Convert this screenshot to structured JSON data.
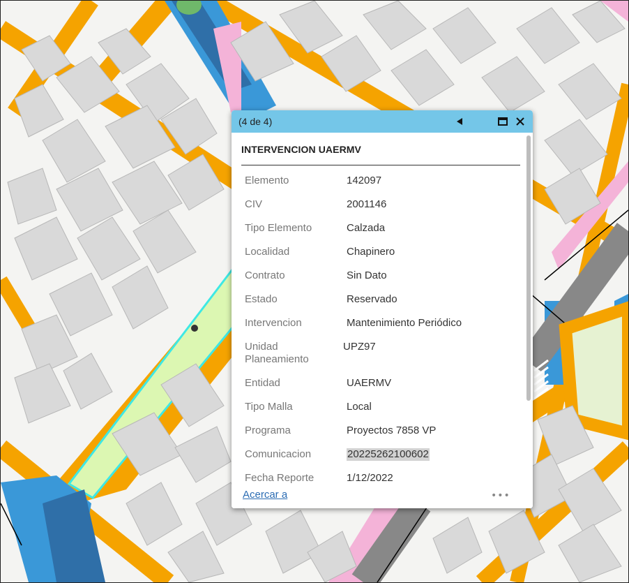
{
  "popup": {
    "counter": "(4 de 4)",
    "prev_icon": "triangle-left-icon",
    "maximize_icon": "maximize-icon",
    "close_icon": "close-icon",
    "title": "INTERVENCION UAERMV",
    "rows": [
      {
        "label": "Elemento",
        "value": "142097"
      },
      {
        "label": "CIV",
        "value": "2001146"
      },
      {
        "label": "Tipo Elemento",
        "value": "Calzada"
      },
      {
        "label": "Localidad",
        "value": "Chapinero"
      },
      {
        "label": "Contrato",
        "value": "Sin Dato"
      },
      {
        "label": "Estado",
        "value": "Reservado"
      },
      {
        "label": "Intervencion",
        "value": "Mantenimiento Periódico"
      },
      {
        "label": "Unidad Planeamiento",
        "value": "UPZ97"
      },
      {
        "label": "Entidad",
        "value": "UAERMV"
      },
      {
        "label": "Tipo Malla",
        "value": "Local"
      },
      {
        "label": "Programa",
        "value": "Proyectos 7858 VP"
      },
      {
        "label": "Comunicacion",
        "value": "20225262100602"
      },
      {
        "label": "Fecha Reporte",
        "value": "1/12/2022"
      }
    ],
    "zoom_link": "Acercar a",
    "more_label": "•••"
  },
  "colors": {
    "header": "#74c6e8",
    "road": "#f5a300",
    "building": "#d9d9d9",
    "selected_outline": "#3ee8e4",
    "selected_fill": "#dcf7b2",
    "avenue": "#3a98d8",
    "bike_lane": "#f4b3d8"
  }
}
